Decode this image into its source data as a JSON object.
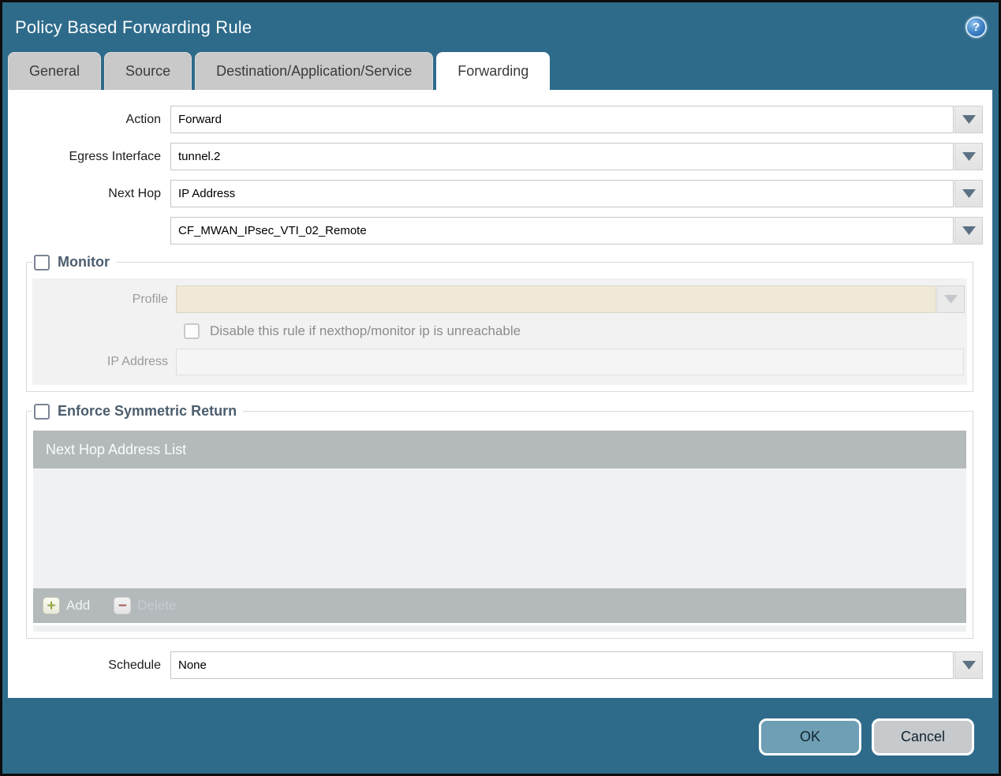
{
  "window": {
    "title": "Policy Based Forwarding Rule"
  },
  "tabs": [
    {
      "label": "General",
      "active": false
    },
    {
      "label": "Source",
      "active": false
    },
    {
      "label": "Destination/Application/Service",
      "active": false
    },
    {
      "label": "Forwarding",
      "active": true
    }
  ],
  "form": {
    "action": {
      "label": "Action",
      "value": "Forward"
    },
    "egress_interface": {
      "label": "Egress Interface",
      "value": "tunnel.2"
    },
    "next_hop": {
      "label": "Next Hop",
      "value": "IP Address"
    },
    "next_hop_address": {
      "value": "CF_MWAN_IPsec_VTI_02_Remote"
    },
    "schedule": {
      "label": "Schedule",
      "value": "None"
    }
  },
  "monitor": {
    "legend": "Monitor",
    "checked": false,
    "profile": {
      "label": "Profile",
      "value": ""
    },
    "disable_rule_checkbox": {
      "label": "Disable this rule if nexthop/monitor ip is unreachable",
      "checked": false
    },
    "ip_address": {
      "label": "IP Address",
      "value": ""
    }
  },
  "symmetric_return": {
    "legend": "Enforce Symmetric Return",
    "checked": false,
    "table": {
      "header": "Next Hop Address List",
      "rows": []
    },
    "add_label": "Add",
    "delete_label": "Delete"
  },
  "footer": {
    "ok_label": "OK",
    "cancel_label": "Cancel"
  },
  "icons": {
    "help": "?",
    "add": "+",
    "delete": "−",
    "dropdown_arrow": "chevron-down"
  },
  "colors": {
    "titlebar": "#2E6B8B",
    "tab_inactive": "#C9C9C9",
    "table_header": "#B4B9BC",
    "disabled_field": "#F0E9D7",
    "ok_button": "#6E9FB4",
    "cancel_button": "#C6CACC",
    "arrow": "#5C7183"
  }
}
